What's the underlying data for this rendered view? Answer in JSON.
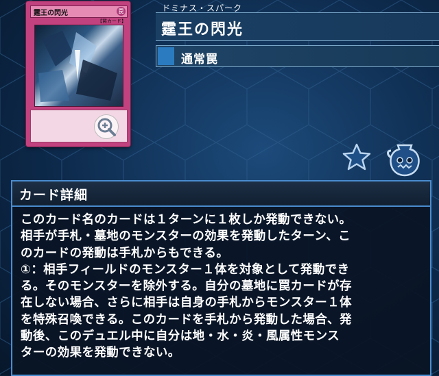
{
  "card": {
    "name": "霆王の閃光",
    "ruby": "ドミナス・スパーク",
    "type": "通常罠",
    "thumb_name": "霆王の閃光",
    "thumb_attr": "罠",
    "thumb_type": "【罠カード】"
  },
  "icons": {
    "zoom": "zoom-in-icon",
    "favorite": "star-icon",
    "deck": "deck-jar-icon"
  },
  "details": {
    "heading": "カード詳細",
    "lines": [
      "このカード名のカードは１ターンに１枚しか発動できない。",
      "相手が手札・墓地のモンスターの効果を発動したターン、こ",
      "のカードの発動は手札からもできる。",
      "①：相手フィールドのモンスター１体を対象として発動でき",
      "る。そのモンスターを除外する。自分の墓地に罠カードが存",
      "在しない場合、さらに相手は自身の手札からモンスター１体",
      "を特殊召喚できる。このカードを手札から発動した場合、発",
      "動後、このデュエル中に自分は地・水・炎・風属性モンス",
      "ターの効果を発動できない。"
    ]
  },
  "colors": {
    "trap_card": "#c2427f",
    "panel_border": "#4a8ccf",
    "type_swatch": "#2b7bc0"
  }
}
